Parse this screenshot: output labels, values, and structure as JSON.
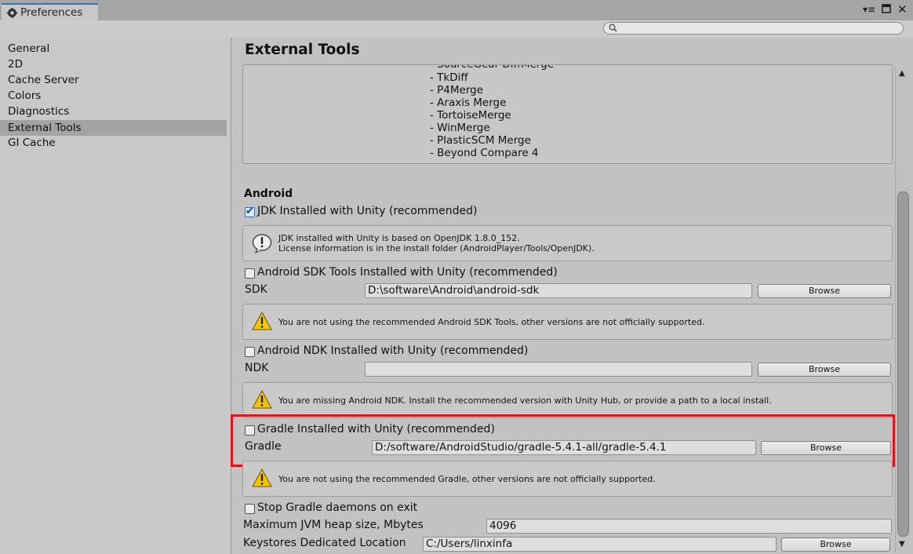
{
  "window": {
    "tab_title": "Preferences",
    "icons": [
      "settings-cog-icon",
      "window-menu-icon",
      "maximize-icon",
      "close-icon"
    ]
  },
  "search": {
    "value": "",
    "placeholder": ""
  },
  "sidebar": {
    "items": [
      {
        "label": "General"
      },
      {
        "label": "2D"
      },
      {
        "label": "Cache Server"
      },
      {
        "label": "Colors"
      },
      {
        "label": "Diagnostics"
      },
      {
        "label": "External Tools",
        "selected": true
      },
      {
        "label": "GI Cache"
      }
    ]
  },
  "main": {
    "title": "External Tools",
    "diff_tools": [
      "- SourceGear DiffMerge",
      "- TkDiff",
      "- P4Merge",
      "- Araxis Merge",
      "- TortoiseMerge",
      "- WinMerge",
      "- PlasticSCM Merge",
      "- Beyond Compare 4"
    ],
    "android": {
      "heading": "Android",
      "jdk_label": "JDK Installed with Unity (recommended)",
      "jdk_checked": true,
      "jdk_info_line1": "JDK installed with Unity is based on OpenJDK 1.8.0_152.",
      "jdk_info_line2": "License information is in the install folder (AndroidPlayer/Tools/OpenJDK).",
      "sdk_checkbox_label": "Android SDK Tools Installed with Unity (recommended)",
      "sdk_checked": false,
      "sdk_label": "SDK",
      "sdk_path": "D:\\software\\Android\\android-sdk",
      "sdk_warning": "You are not using the recommended Android SDK Tools, other versions are not officially supported.",
      "ndk_checkbox_label": "Android NDK Installed with Unity (recommended)",
      "ndk_checked": false,
      "ndk_label": "NDK",
      "ndk_path": "",
      "ndk_warning": "You are missing Android NDK. Install the recommended version with Unity Hub, or provide a path to a local install.",
      "gradle_checkbox_label": "Gradle Installed with Unity (recommended)",
      "gradle_checked": false,
      "gradle_label": "Gradle",
      "gradle_path": "D:/software/AndroidStudio/gradle-5.4.1-all/gradle-5.4.1",
      "gradle_warning": "You are not using the recommended Gradle, other versions are not officially supported.",
      "stop_gradle_label": "Stop Gradle daemons on exit",
      "stop_gradle_checked": false,
      "jvm_heap_label": "Maximum JVM heap size, Mbytes",
      "jvm_heap_value": "4096",
      "keystores_label": "Keystores Dedicated Location",
      "keystores_path": "C:/Users/linxinfa",
      "browse_label": "Browse"
    }
  },
  "colors": {
    "highlight": "#e0141a",
    "selected_item": "#a3a3a3",
    "warning_fill": "#f5c400"
  }
}
